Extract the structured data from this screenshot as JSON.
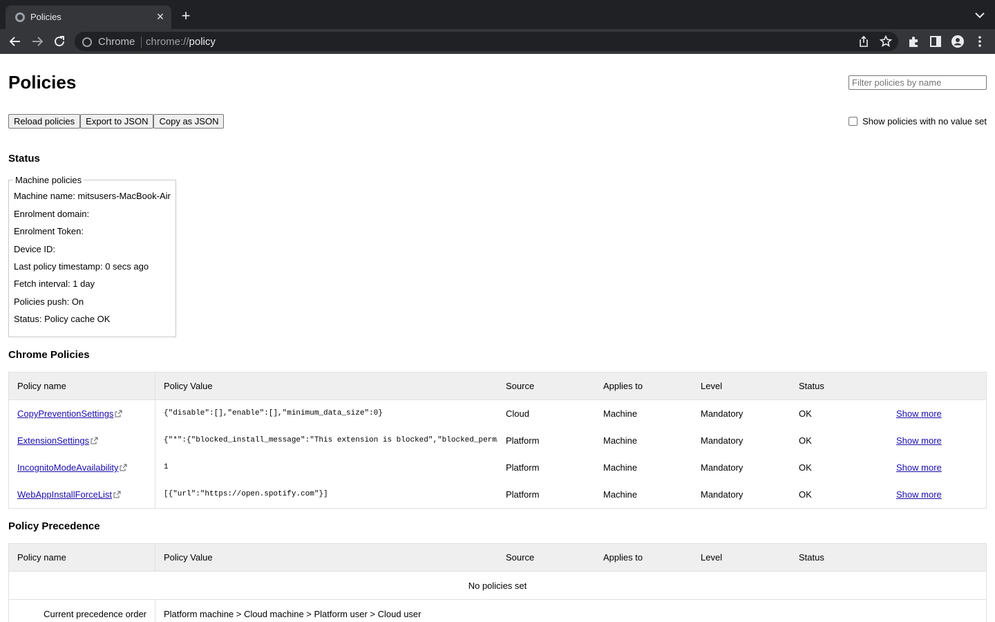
{
  "browser": {
    "tab_title": "Policies",
    "omnibox_chip": "Chrome",
    "url_scheme": "chrome://",
    "url_host": "policy"
  },
  "page": {
    "title": "Policies",
    "filter_placeholder": "Filter policies by name",
    "buttons": {
      "reload": "Reload policies",
      "export": "Export to JSON",
      "copy": "Copy as JSON"
    },
    "show_no_value_label": "Show policies with no value set",
    "show_no_value_checked": false
  },
  "status": {
    "heading": "Status",
    "legend": "Machine policies",
    "lines": [
      "Machine name: mitsusers-MacBook-Air",
      "Enrolment domain:",
      "Enrolment Token:",
      "Device ID:",
      "Last policy timestamp: 0 secs ago",
      "Fetch interval: 1 day",
      "Policies push: On",
      "Status: Policy cache OK"
    ]
  },
  "columns": {
    "name": "Policy name",
    "value": "Policy Value",
    "source": "Source",
    "applies": "Applies to",
    "level": "Level",
    "status": "Status"
  },
  "chrome_policies": {
    "heading": "Chrome Policies",
    "rows": [
      {
        "name": "CopyPreventionSettings",
        "value": "{\"disable\":[],\"enable\":[],\"minimum_data_size\":0}",
        "source": "Cloud",
        "applies": "Machine",
        "level": "Mandatory",
        "status": "OK",
        "more": "Show more"
      },
      {
        "name": "ExtensionSettings",
        "value": "{\"*\":{\"blocked_install_message\":\"This extension is blocked\",\"blocked_perm…",
        "source": "Platform",
        "applies": "Machine",
        "level": "Mandatory",
        "status": "OK",
        "more": "Show more"
      },
      {
        "name": "IncognitoModeAvailability",
        "value": "1",
        "source": "Platform",
        "applies": "Machine",
        "level": "Mandatory",
        "status": "OK",
        "more": "Show more"
      },
      {
        "name": "WebAppInstallForceList",
        "value": "[{\"url\":\"https://open.spotify.com\"}]",
        "source": "Platform",
        "applies": "Machine",
        "level": "Mandatory",
        "status": "OK",
        "more": "Show more"
      }
    ]
  },
  "precedence": {
    "heading": "Policy Precedence",
    "empty_text": "No policies set",
    "order_label": "Current precedence order",
    "order_value": "Platform machine > Cloud machine > Platform user > Cloud user"
  },
  "colors": {
    "tabstrip": "#202124",
    "toolbar": "#35363a",
    "link": "#1a0dab",
    "table_header": "#efefef"
  }
}
